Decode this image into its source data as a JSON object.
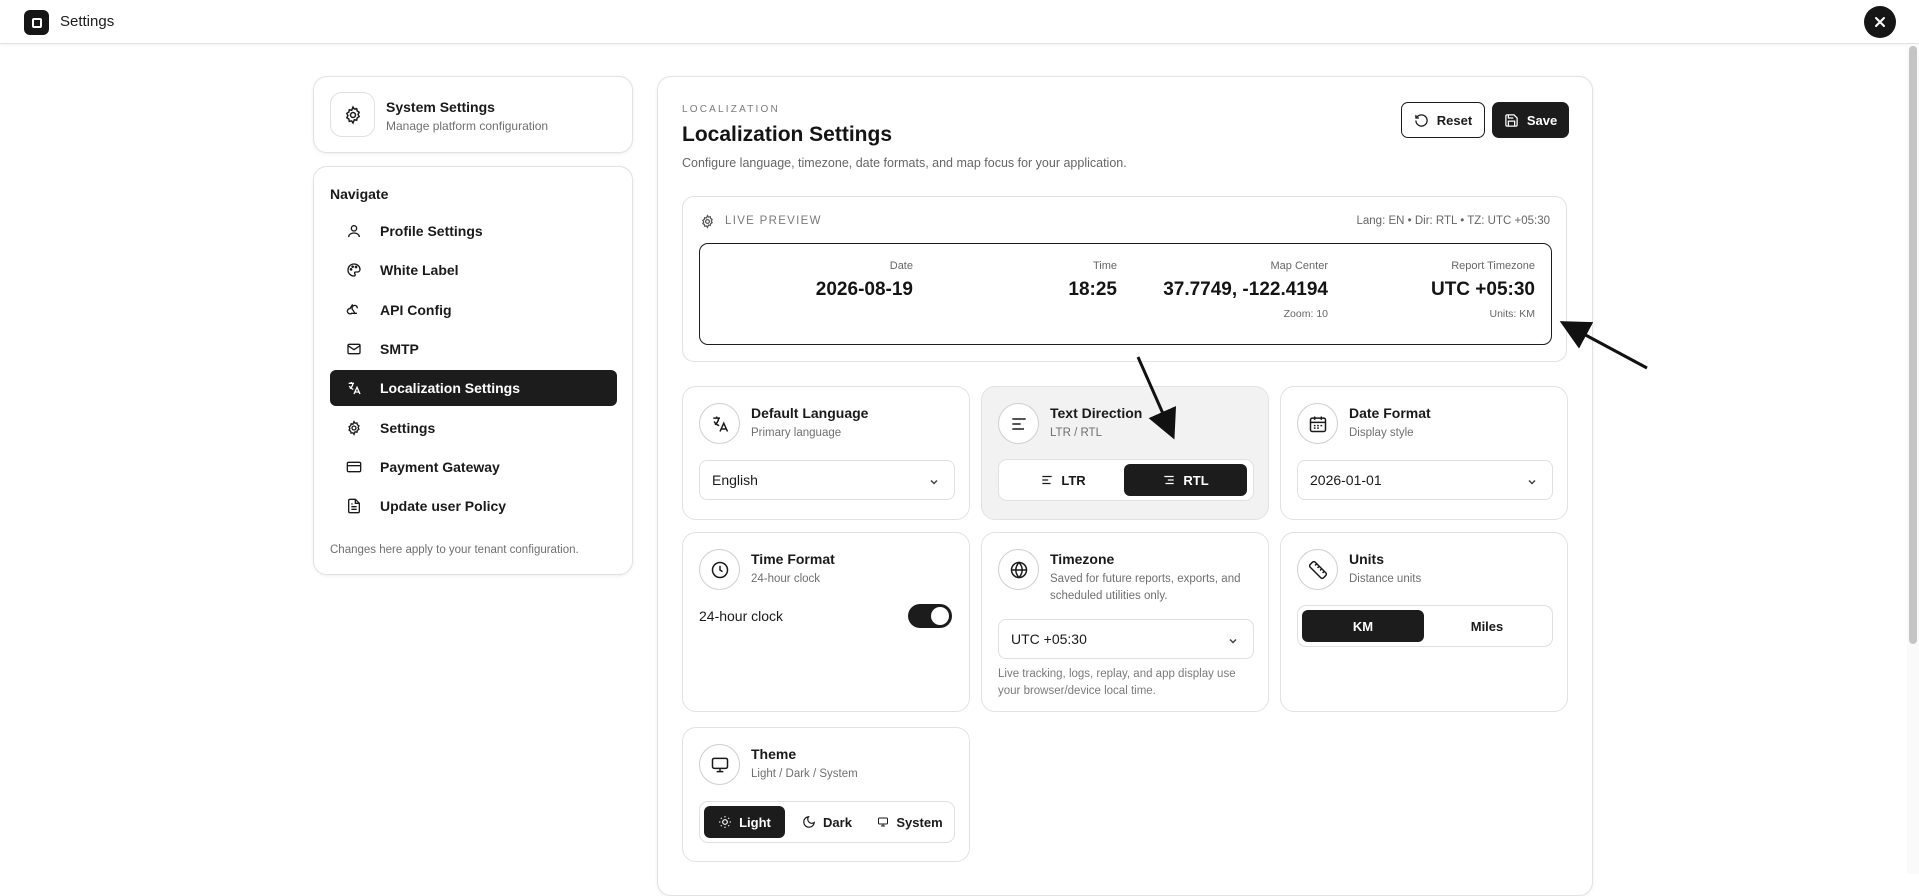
{
  "topbar": {
    "title": "Settings"
  },
  "sidebar": {
    "system": {
      "title": "System Settings",
      "subtitle": "Manage platform configuration"
    },
    "nav_heading": "Navigate",
    "items": [
      {
        "label": "Profile Settings",
        "icon": "user-icon"
      },
      {
        "label": "White Label",
        "icon": "palette-icon"
      },
      {
        "label": "API Config",
        "icon": "webhook-icon"
      },
      {
        "label": "SMTP",
        "icon": "mail-icon"
      },
      {
        "label": "Localization Settings",
        "icon": "languages-icon",
        "active": true
      },
      {
        "label": "Settings",
        "icon": "gear-icon"
      },
      {
        "label": "Payment Gateway",
        "icon": "credit-card-icon"
      },
      {
        "label": "Update user Policy",
        "icon": "file-text-icon"
      }
    ],
    "footer": "Changes here apply to your tenant configuration."
  },
  "main": {
    "eyebrow": "LOCALIZATION",
    "title": "Localization Settings",
    "subtitle": "Configure language, timezone, date formats, and map focus for your application.",
    "reset_label": "Reset",
    "save_label": "Save"
  },
  "preview": {
    "label": "LIVE PREVIEW",
    "meta": "Lang: EN • Dir: RTL • TZ: UTC +05:30",
    "date": {
      "key": "Date",
      "value": "2026-08-19"
    },
    "time": {
      "key": "Time",
      "value": "18:25"
    },
    "map": {
      "key": "Map Center",
      "value": "37.7749, -122.4194",
      "sub": "Zoom: 10"
    },
    "tz": {
      "key": "Report Timezone",
      "value": "UTC +05:30",
      "sub": "Units: KM"
    }
  },
  "cards": {
    "language": {
      "title": "Default Language",
      "subtitle": "Primary language",
      "value": "English",
      "icon": "languages-icon"
    },
    "direction": {
      "title": "Text Direction",
      "subtitle": "LTR / RTL",
      "options": [
        "LTR",
        "RTL"
      ],
      "selected": "RTL",
      "icon": "align-left-icon"
    },
    "date_format": {
      "title": "Date Format",
      "subtitle": "Display style",
      "value": "2026-01-01",
      "icon": "calendar-icon"
    },
    "time_format": {
      "title": "Time Format",
      "subtitle": "24-hour clock",
      "toggle_label": "24-hour clock",
      "enabled": true,
      "icon": "clock-icon"
    },
    "timezone": {
      "title": "Timezone",
      "subtitle": "Saved for future reports, exports, and scheduled utilities only.",
      "value": "UTC +05:30",
      "note": "Live tracking, logs, replay, and app display use your browser/device local time.",
      "icon": "globe-icon"
    },
    "units": {
      "title": "Units",
      "subtitle": "Distance units",
      "options": [
        "KM",
        "Miles"
      ],
      "selected": "KM",
      "icon": "ruler-icon"
    },
    "theme": {
      "title": "Theme",
      "subtitle": "Light / Dark / System",
      "options": [
        "Light",
        "Dark",
        "System"
      ],
      "selected": "Light",
      "icon": "monitor-icon"
    }
  },
  "colors": {
    "accent": "#1c1c1c",
    "border": "#e2e2e2",
    "muted": "#6f6f6f"
  }
}
